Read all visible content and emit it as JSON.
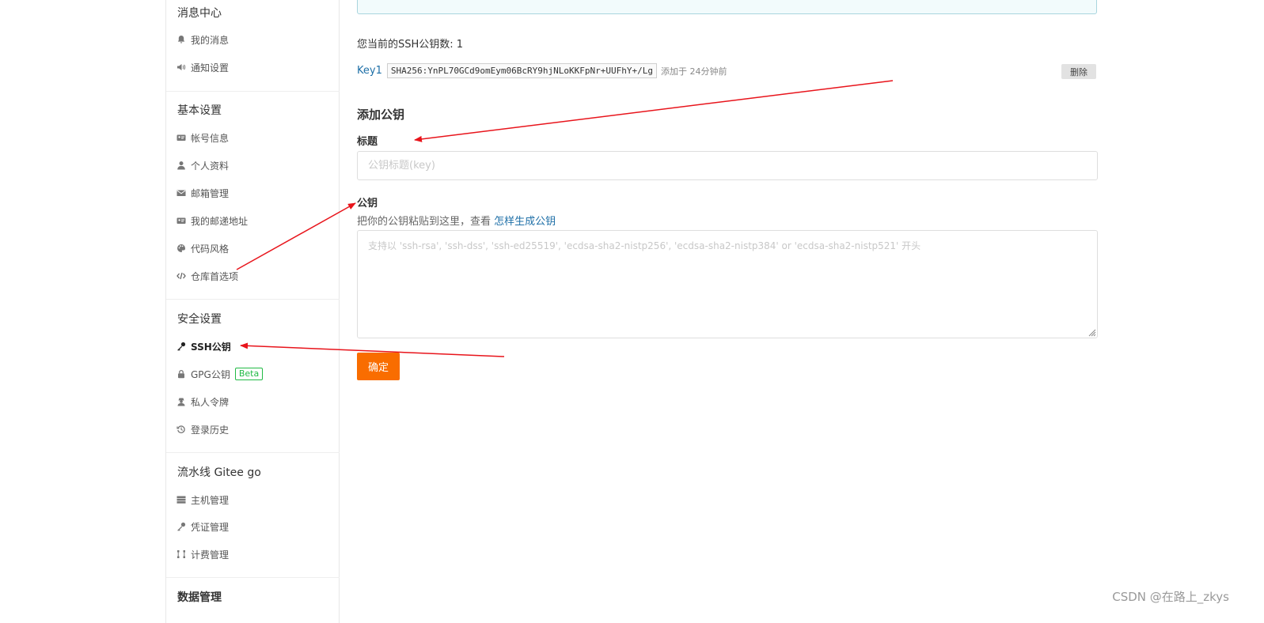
{
  "sidebar": {
    "messages": {
      "title": "消息中心",
      "items": [
        "我的消息",
        "通知设置"
      ]
    },
    "basic": {
      "title": "基本设置",
      "items": [
        "帐号信息",
        "个人资料",
        "邮箱管理",
        "我的邮递地址",
        "代码风格",
        "仓库首选项"
      ]
    },
    "security": {
      "title": "安全设置",
      "items": [
        "SSH公钥",
        "GPG公钥",
        "私人令牌",
        "登录历史"
      ],
      "beta_label": "Beta"
    },
    "pipeline": {
      "title": "流水线 Gitee go",
      "items": [
        "主机管理",
        "凭证管理",
        "计费管理"
      ]
    },
    "data": {
      "title": "数据管理"
    }
  },
  "main": {
    "key_count_text": "您当前的SSH公钥数: 1",
    "key": {
      "name": "Key1",
      "fingerprint": "SHA256:YnPL70GCd9omEym06BcRY9hjNLoKKFpNr+UUFhY+/Lg",
      "added_time": "添加于 24分钟前",
      "delete_label": "删除"
    },
    "add_section_title": "添加公钥",
    "title_label": "标题",
    "title_placeholder": "公钥标题(key)",
    "pubkey_label": "公钥",
    "hint_text": "把你的公钥粘贴到这里，查看 ",
    "hint_link": "怎样生成公钥",
    "pubkey_placeholder": "支持以 'ssh-rsa', 'ssh-dss', 'ssh-ed25519', 'ecdsa-sha2-nistp256', 'ecdsa-sha2-nistp384' or 'ecdsa-sha2-nistp521' 开头",
    "confirm_label": "确定"
  },
  "watermark": "CSDN @在路上_zkys",
  "colors": {
    "accent_orange": "#f96d00",
    "link_blue": "#1e6fa7",
    "annotation_red": "#e8141b",
    "beta_green": "#21ba45"
  },
  "icons": {
    "我的消息": "bell-icon",
    "通知设置": "speaker-icon",
    "帐号信息": "id-card-icon",
    "个人资料": "user-icon",
    "邮箱管理": "envelope-icon",
    "我的邮递地址": "address-card-icon",
    "代码风格": "palette-icon",
    "仓库首选项": "code-icon",
    "SSH公钥": "key-icon",
    "GPG公钥": "lock-icon",
    "私人令牌": "user-secret-icon",
    "登录历史": "history-icon",
    "主机管理": "server-icon",
    "凭证管理": "key-icon",
    "计费管理": "billing-icon"
  }
}
